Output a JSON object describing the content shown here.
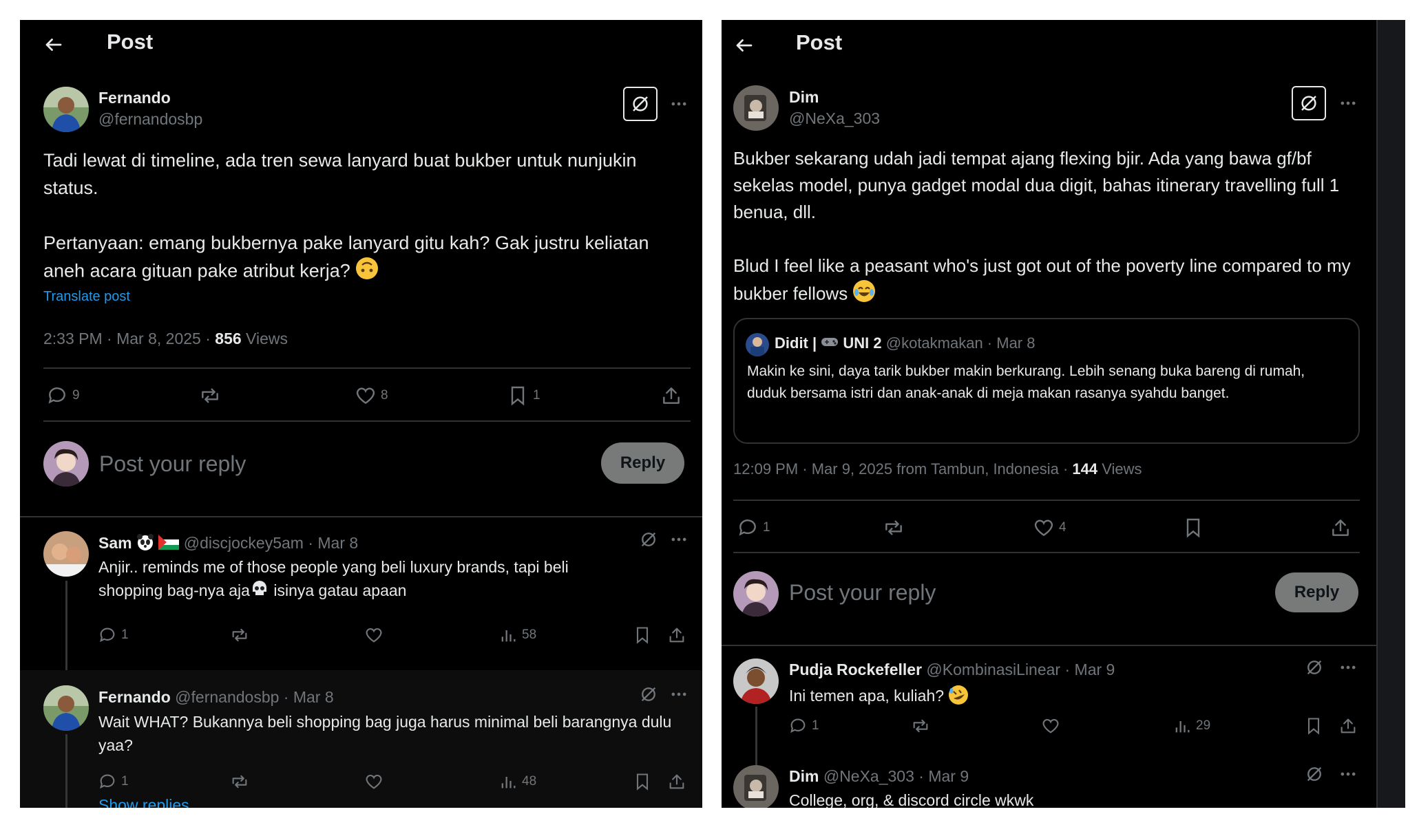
{
  "left": {
    "header_title": "Post",
    "main": {
      "name": "Fernando",
      "handle": "@fernandosbp",
      "text_p1": "Tadi lewat di timeline, ada tren sewa lanyard buat bukber untuk nunjukin status.",
      "text_p2": "Pertanyaan: emang bukbernya pake lanyard gitu kah? Gak justru keliatan aneh acara gituan pake atribut kerja?",
      "translate": "Translate post",
      "time": "2:33 PM · Mar 8, 2025 · ",
      "views_count": "856",
      "views_label": " Views",
      "replies": "9",
      "likes": "8",
      "bookmarks": "1"
    },
    "compose": {
      "placeholder": "Post your reply",
      "button": "Reply"
    },
    "replies": [
      {
        "name": "Sam",
        "handle": "@discjockey5am · Mar 8",
        "text_a": "Anjir.. reminds me of those people yang beli luxury brands, tapi beli",
        "text_b": "shopping bag-nya aja",
        "text_c": " isinya gatau apaan",
        "reply_count": "1",
        "views": "58"
      },
      {
        "name": "Fernando",
        "handle": "@fernandosbp · Mar 8",
        "text": "Wait WHAT? Bukannya beli shopping bag juga harus minimal beli barangnya dulu yaa?",
        "reply_count": "1",
        "views": "48"
      }
    ],
    "show_replies": "Show replies"
  },
  "right": {
    "header_title": "Post",
    "main": {
      "name": "Dim",
      "handle": "@NeXa_303",
      "text_p1": "Bukber sekarang udah jadi tempat ajang flexing bjir. Ada yang bawa gf/bf sekelas model, punya gadget modal dua digit, bahas itinerary travelling full 1 benua, dll.",
      "text_p2": "Blud I feel like a peasant who's just got out of the poverty line compared to my bukber fellows",
      "quote": {
        "name": "Didit | ",
        "name_suffix": " UNI 2",
        "handle": "@kotakmakan · Mar 8",
        "text": "Makin ke sini, daya tarik bukber makin berkurang. Lebih senang buka bareng di rumah, duduk bersama istri dan anak-anak di meja makan rasanya syahdu banget."
      },
      "time": "12:09 PM · Mar 9, 2025 from Tambun, Indonesia · ",
      "views_count": "144",
      "views_label": " Views",
      "replies": "1",
      "likes": "4"
    },
    "compose": {
      "placeholder": "Post your reply",
      "button": "Reply"
    },
    "replies": [
      {
        "name": "Pudja Rockefeller",
        "handle": "@KombinasiLinear · Mar 9",
        "text": "Ini temen apa, kuliah?",
        "reply_count": "1",
        "views": "29"
      },
      {
        "name": "Dim",
        "handle": "@NeXa_303 · Mar 9",
        "text": "College, org, & discord circle wkwk"
      }
    ]
  },
  "colors": {
    "background": "#000000",
    "text": "#e7e9ea",
    "muted": "#71767b",
    "link": "#1d9bf0",
    "divider": "#2f3336"
  }
}
